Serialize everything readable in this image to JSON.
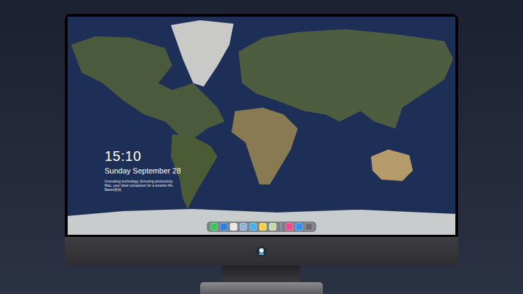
{
  "lock_screen": {
    "time": "15:10",
    "date": "Sunday September 28",
    "tagline": "Innovating technology, Ensuring productivity. Mac, your ideal companion for a smarter life. Based系统"
  },
  "dock": {
    "groups": [
      {
        "apps": [
          {
            "color": "#3bc45a"
          },
          {
            "color": "#2f7fe0"
          },
          {
            "color": "#e8e8e8"
          },
          {
            "color": "#8fb4d8"
          },
          {
            "color": "#4fb0e8"
          },
          {
            "color": "#f5d14a"
          },
          {
            "color": "#c9d8a8"
          }
        ]
      },
      {
        "apps": [
          {
            "color": "#f04a8c"
          },
          {
            "color": "#3a8ff0"
          },
          {
            "color": "#6b6b70"
          }
        ]
      }
    ]
  }
}
